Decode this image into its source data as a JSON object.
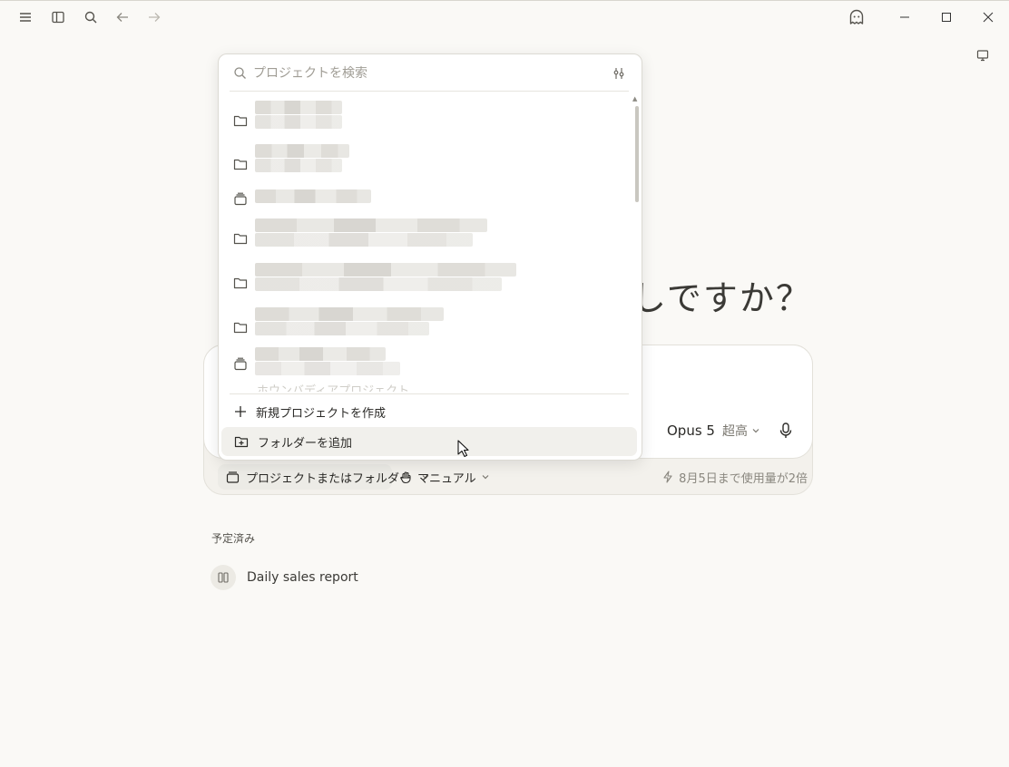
{
  "titlebar": {
    "icons": [
      "menu-icon",
      "sidebar-toggle-icon",
      "search-icon",
      "back-icon",
      "forward-icon",
      "ghost-icon"
    ],
    "window_controls": [
      "minimize-icon",
      "maximize-icon",
      "close-icon"
    ],
    "right_panel_icon": "monitor-icon"
  },
  "greeting": {
    "visible_text": "しですか？"
  },
  "composer": {
    "model": "Opus 5",
    "effort": "超高",
    "project_selector": "プロジェクトまたはフォルダー",
    "mode": "マニュアル",
    "usage_note": "8月5日まで使用量が2倍"
  },
  "scheduled": {
    "heading": "予定済み",
    "items": [
      {
        "label": "Daily sales report"
      }
    ]
  },
  "project_dropdown": {
    "search_placeholder": "プロジェクトを検索",
    "items": [
      {
        "icon": "folder-icon",
        "redacted": true
      },
      {
        "icon": "folder-icon",
        "redacted": true
      },
      {
        "icon": "stack-icon",
        "redacted": true
      },
      {
        "icon": "folder-icon",
        "redacted": true
      },
      {
        "icon": "folder-icon",
        "redacted": true
      },
      {
        "icon": "folder-icon",
        "redacted": true
      },
      {
        "icon": "stack-icon",
        "redacted": true
      }
    ],
    "partially_visible_item": "ホウンバディアプロジェクト",
    "actions": [
      {
        "label": "新規プロジェクトを作成",
        "icon": "plus-icon"
      },
      {
        "label": "フォルダーを追加",
        "icon": "add-folder-icon",
        "hovered": true
      }
    ]
  },
  "colors": {
    "background": "#faf9f6",
    "panel": "#ffffff",
    "hover": "#f1f0ec"
  }
}
